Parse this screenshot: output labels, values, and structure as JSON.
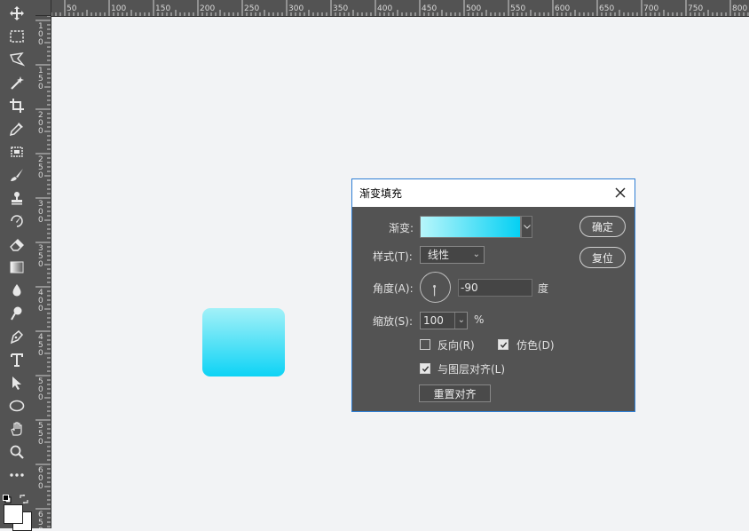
{
  "toolbar": {
    "tools": [
      {
        "name": "move-icon"
      },
      {
        "name": "marquee-icon"
      },
      {
        "name": "lasso-icon"
      },
      {
        "name": "magic-wand-icon"
      },
      {
        "name": "crop-icon"
      },
      {
        "name": "eyedropper-icon"
      },
      {
        "name": "healing-brush-icon"
      },
      {
        "name": "brush-icon"
      },
      {
        "name": "clone-stamp-icon"
      },
      {
        "name": "history-brush-icon"
      },
      {
        "name": "eraser-icon"
      },
      {
        "name": "gradient-icon"
      },
      {
        "name": "blur-icon"
      },
      {
        "name": "dodge-icon"
      },
      {
        "name": "pen-icon"
      },
      {
        "name": "type-icon"
      },
      {
        "name": "path-selection-icon"
      },
      {
        "name": "ellipse-icon"
      },
      {
        "name": "hand-icon"
      },
      {
        "name": "zoom-icon"
      },
      {
        "name": "more-tools-icon"
      }
    ]
  },
  "ruler": {
    "h_labels": [
      "50",
      "100",
      "150",
      "200",
      "250",
      "300",
      "350",
      "400",
      "450",
      "500",
      "550",
      "600",
      "650",
      "700",
      "750",
      "800"
    ],
    "v_labels": [
      "100",
      "150",
      "200",
      "250",
      "300",
      "350",
      "400",
      "450",
      "500",
      "550",
      "600",
      "650"
    ]
  },
  "canvas": {
    "gradient_start": "#a3f1f8",
    "gradient_end": "#0ed3f5"
  },
  "dialog": {
    "title": "渐变填充",
    "gradient_label": "渐变:",
    "style_label": "样式(T):",
    "style_value": "线性",
    "angle_label": "角度(A):",
    "angle_value": "-90",
    "angle_unit": "度",
    "scale_label": "缩放(S):",
    "scale_value": "100",
    "scale_unit": "%",
    "reverse_label": "反向(R)",
    "reverse_checked": false,
    "dither_label": "仿色(D)",
    "dither_checked": true,
    "align_label": "与图层对齐(L)",
    "align_checked": true,
    "reset_align_label": "重置对齐",
    "ok_label": "确定",
    "reset_label": "复位"
  }
}
